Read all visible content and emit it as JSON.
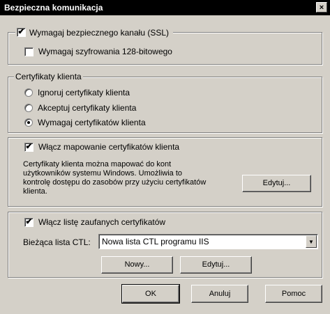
{
  "window": {
    "title": "Bezpieczna komunikacja",
    "close_glyph": "×"
  },
  "ssl": {
    "require_ssl_label": "Wymagaj bezpiecznego kanału (SSL)",
    "require_ssl_checked": true,
    "require_128_label": "Wymagaj szyfrowania 128-bitowego",
    "require_128_checked": false
  },
  "client_certs": {
    "legend": "Certyfikaty klienta",
    "options": [
      {
        "label": "Ignoruj certyfikaty klienta",
        "selected": false
      },
      {
        "label": "Akceptuj certyfikaty klienta",
        "selected": false
      },
      {
        "label": "Wymagaj certyfikatów klienta",
        "selected": true
      }
    ]
  },
  "mapping": {
    "checkbox_label": "Włącz mapowanie certyfikatów klienta",
    "checked": true,
    "description_lines": [
      "Certyfikaty klienta można mapować do kont",
      "użytkowników systemu Windows. Umożliwia to",
      "kontrolę dostępu do zasobów przy użyciu certyfikatów",
      "klienta."
    ],
    "edit_button": "Edytuj..."
  },
  "ctl": {
    "checkbox_label": "Włącz listę zaufanych certyfikatów",
    "checked": true,
    "current_label": "Bieżąca lista CTL:",
    "current_value": "Nowa lista CTL programu IIS",
    "new_button": "Nowy...",
    "edit_button": "Edytuj..."
  },
  "footer": {
    "ok": "OK",
    "cancel": "Anuluj",
    "help": "Pomoc"
  },
  "icons": {
    "check": "✔",
    "dropdown": "▼"
  }
}
